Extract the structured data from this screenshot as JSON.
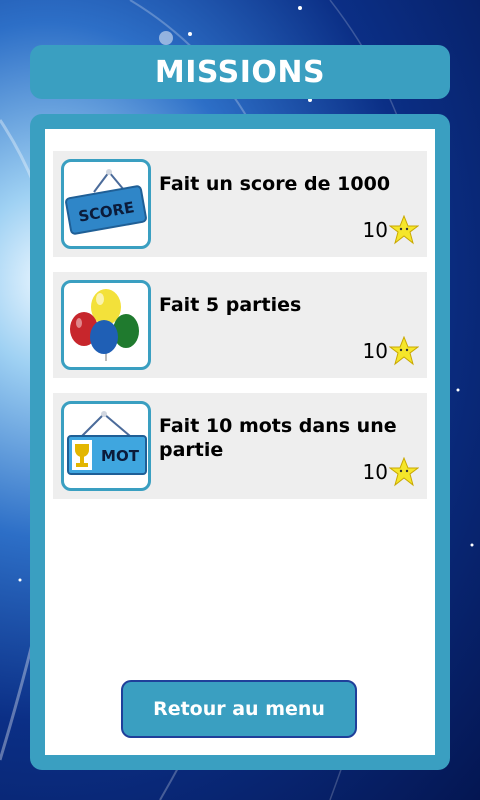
{
  "header": {
    "title": "MISSIONS"
  },
  "missions": [
    {
      "title": "Fait un score de 1000",
      "reward": "10",
      "icon": "score-sign-icon",
      "sign_text": "SCORE"
    },
    {
      "title": "Fait 5 parties",
      "reward": "10",
      "icon": "balloons-icon"
    },
    {
      "title": "Fait 10 mots dans une partie",
      "reward": "10",
      "icon": "mot-sign-icon",
      "sign_text": "MOT"
    }
  ],
  "footer": {
    "back_label": "Retour au menu"
  },
  "colors": {
    "accent": "#3a9fc1",
    "button_border": "#1f3f9a",
    "card_bg": "#eeeeee"
  }
}
